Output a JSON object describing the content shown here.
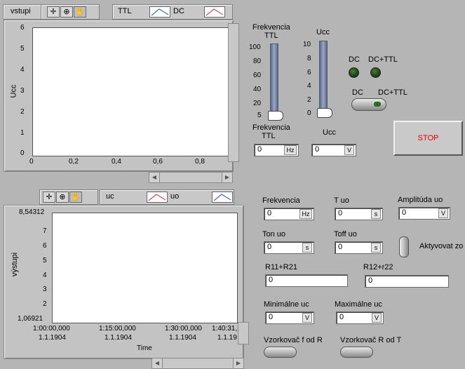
{
  "graph1": {
    "title": "vstupi",
    "legend": [
      {
        "name": "TTL",
        "color": "#1f3fd6"
      },
      {
        "name": "DC",
        "color": "#e02020"
      }
    ],
    "ylabel": "Ucc",
    "yticks": [
      "6",
      "5",
      "4",
      "3",
      "2",
      "1",
      "0"
    ],
    "xticks": [
      "0",
      "0,2",
      "0,4",
      "0,6",
      "0,8"
    ]
  },
  "graph2": {
    "legend": [
      {
        "name": "uc",
        "color": "#e02020"
      },
      {
        "name": "uo",
        "color": "#1f3fd6"
      }
    ],
    "ylabel": "výstupi",
    "ymax": "8,54312",
    "ymin": "1,06921",
    "yticks": [
      "7",
      "6",
      "5",
      "4",
      "3",
      "2"
    ],
    "xticks": [
      {
        "time": "1:00:00,000",
        "date": "1.1.1904"
      },
      {
        "time": "1:15:00,000",
        "date": "1.1.1904"
      },
      {
        "time": "1:30:00,000",
        "date": "1.1.1904"
      },
      {
        "time": "1:40:31,",
        "date": "1.1.19"
      }
    ],
    "xlabel": "Time"
  },
  "freq_slider": {
    "label_line1": "Frekvencia",
    "label_line2": "TTL",
    "ticks": [
      "100",
      "80",
      "60",
      "40",
      "20",
      "5"
    ],
    "value": 5
  },
  "ucc_slider": {
    "label": "Ucc",
    "ticks": [
      "10",
      "8",
      "6",
      "4",
      "2",
      "0"
    ],
    "value": 0
  },
  "leds": {
    "dc": "DC",
    "dc_ttl": "DC+TTL"
  },
  "switch": {
    "left": "DC",
    "right": "DC+TTL"
  },
  "stop_label": "STOP",
  "freq_ttl": {
    "label_line1": "Frekvencia",
    "label_line2": "TTL",
    "value": "0",
    "unit": "Hz"
  },
  "ucc_num": {
    "label": "Ucc",
    "value": "0",
    "unit": "V"
  },
  "frekvencia": {
    "label": "Frekvencia",
    "value": "0",
    "unit": "Hz"
  },
  "t_uo": {
    "label": "T uo",
    "value": "0",
    "unit": "s"
  },
  "amplituda": {
    "label": "Amplitúda uo",
    "value": "0",
    "unit": "V"
  },
  "ton": {
    "label": "Ton uo",
    "value": "0",
    "unit": "s"
  },
  "toff": {
    "label": "Toff uo",
    "value": "0",
    "unit": "s"
  },
  "aktivovat": "Aktyvovat zo",
  "r11": {
    "label": "R11+R21",
    "value": "0"
  },
  "r12": {
    "label": "R12+r22",
    "value": "0"
  },
  "min_uc": {
    "label": "Minimálne  uc",
    "value": "0",
    "unit": "V"
  },
  "max_uc": {
    "label": "Maximálne uc",
    "value": "0",
    "unit": "V"
  },
  "vz_f": "Vzorkovač f od R",
  "vz_r": "Vzorkovač R od T",
  "icons": {
    "cursor": "crosshair-icon",
    "zoom": "zoom-icon",
    "pan": "hand-icon"
  }
}
